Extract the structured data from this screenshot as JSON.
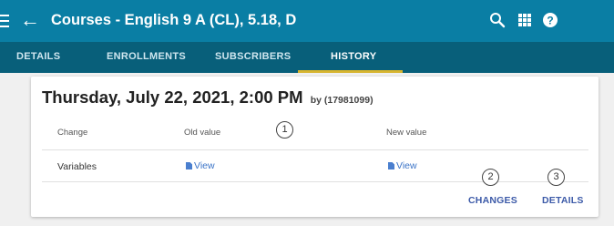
{
  "header": {
    "title": "Courses - English 9 A (CL), 5.18, D",
    "back_icon": "arrow-left-icon",
    "menu_icon": "hamburger-menu-icon",
    "search_icon": "search-icon",
    "apps_icon": "apps-grid-icon",
    "help_icon": "help-icon",
    "background": "#0a7ea4"
  },
  "tabs": [
    {
      "label": "DETAILS",
      "active": false
    },
    {
      "label": "ENROLLMENTS",
      "active": false
    },
    {
      "label": "SUBSCRIBERS",
      "active": false
    },
    {
      "label": "HISTORY",
      "active": true
    }
  ],
  "tabs_accent": "#d7b52f",
  "history_entry": {
    "date": "Thursday, July 22, 2021, 2:00 PM",
    "by": "by (17981099)",
    "columns": {
      "change": "Change",
      "old": "Old value",
      "new": "New value"
    },
    "rows": [
      {
        "change": "Variables",
        "old": "View",
        "new": "View"
      }
    ],
    "actions": {
      "changes": "CHANGES",
      "details": "DETAILS"
    }
  },
  "markers": [
    "1",
    "2",
    "3"
  ]
}
